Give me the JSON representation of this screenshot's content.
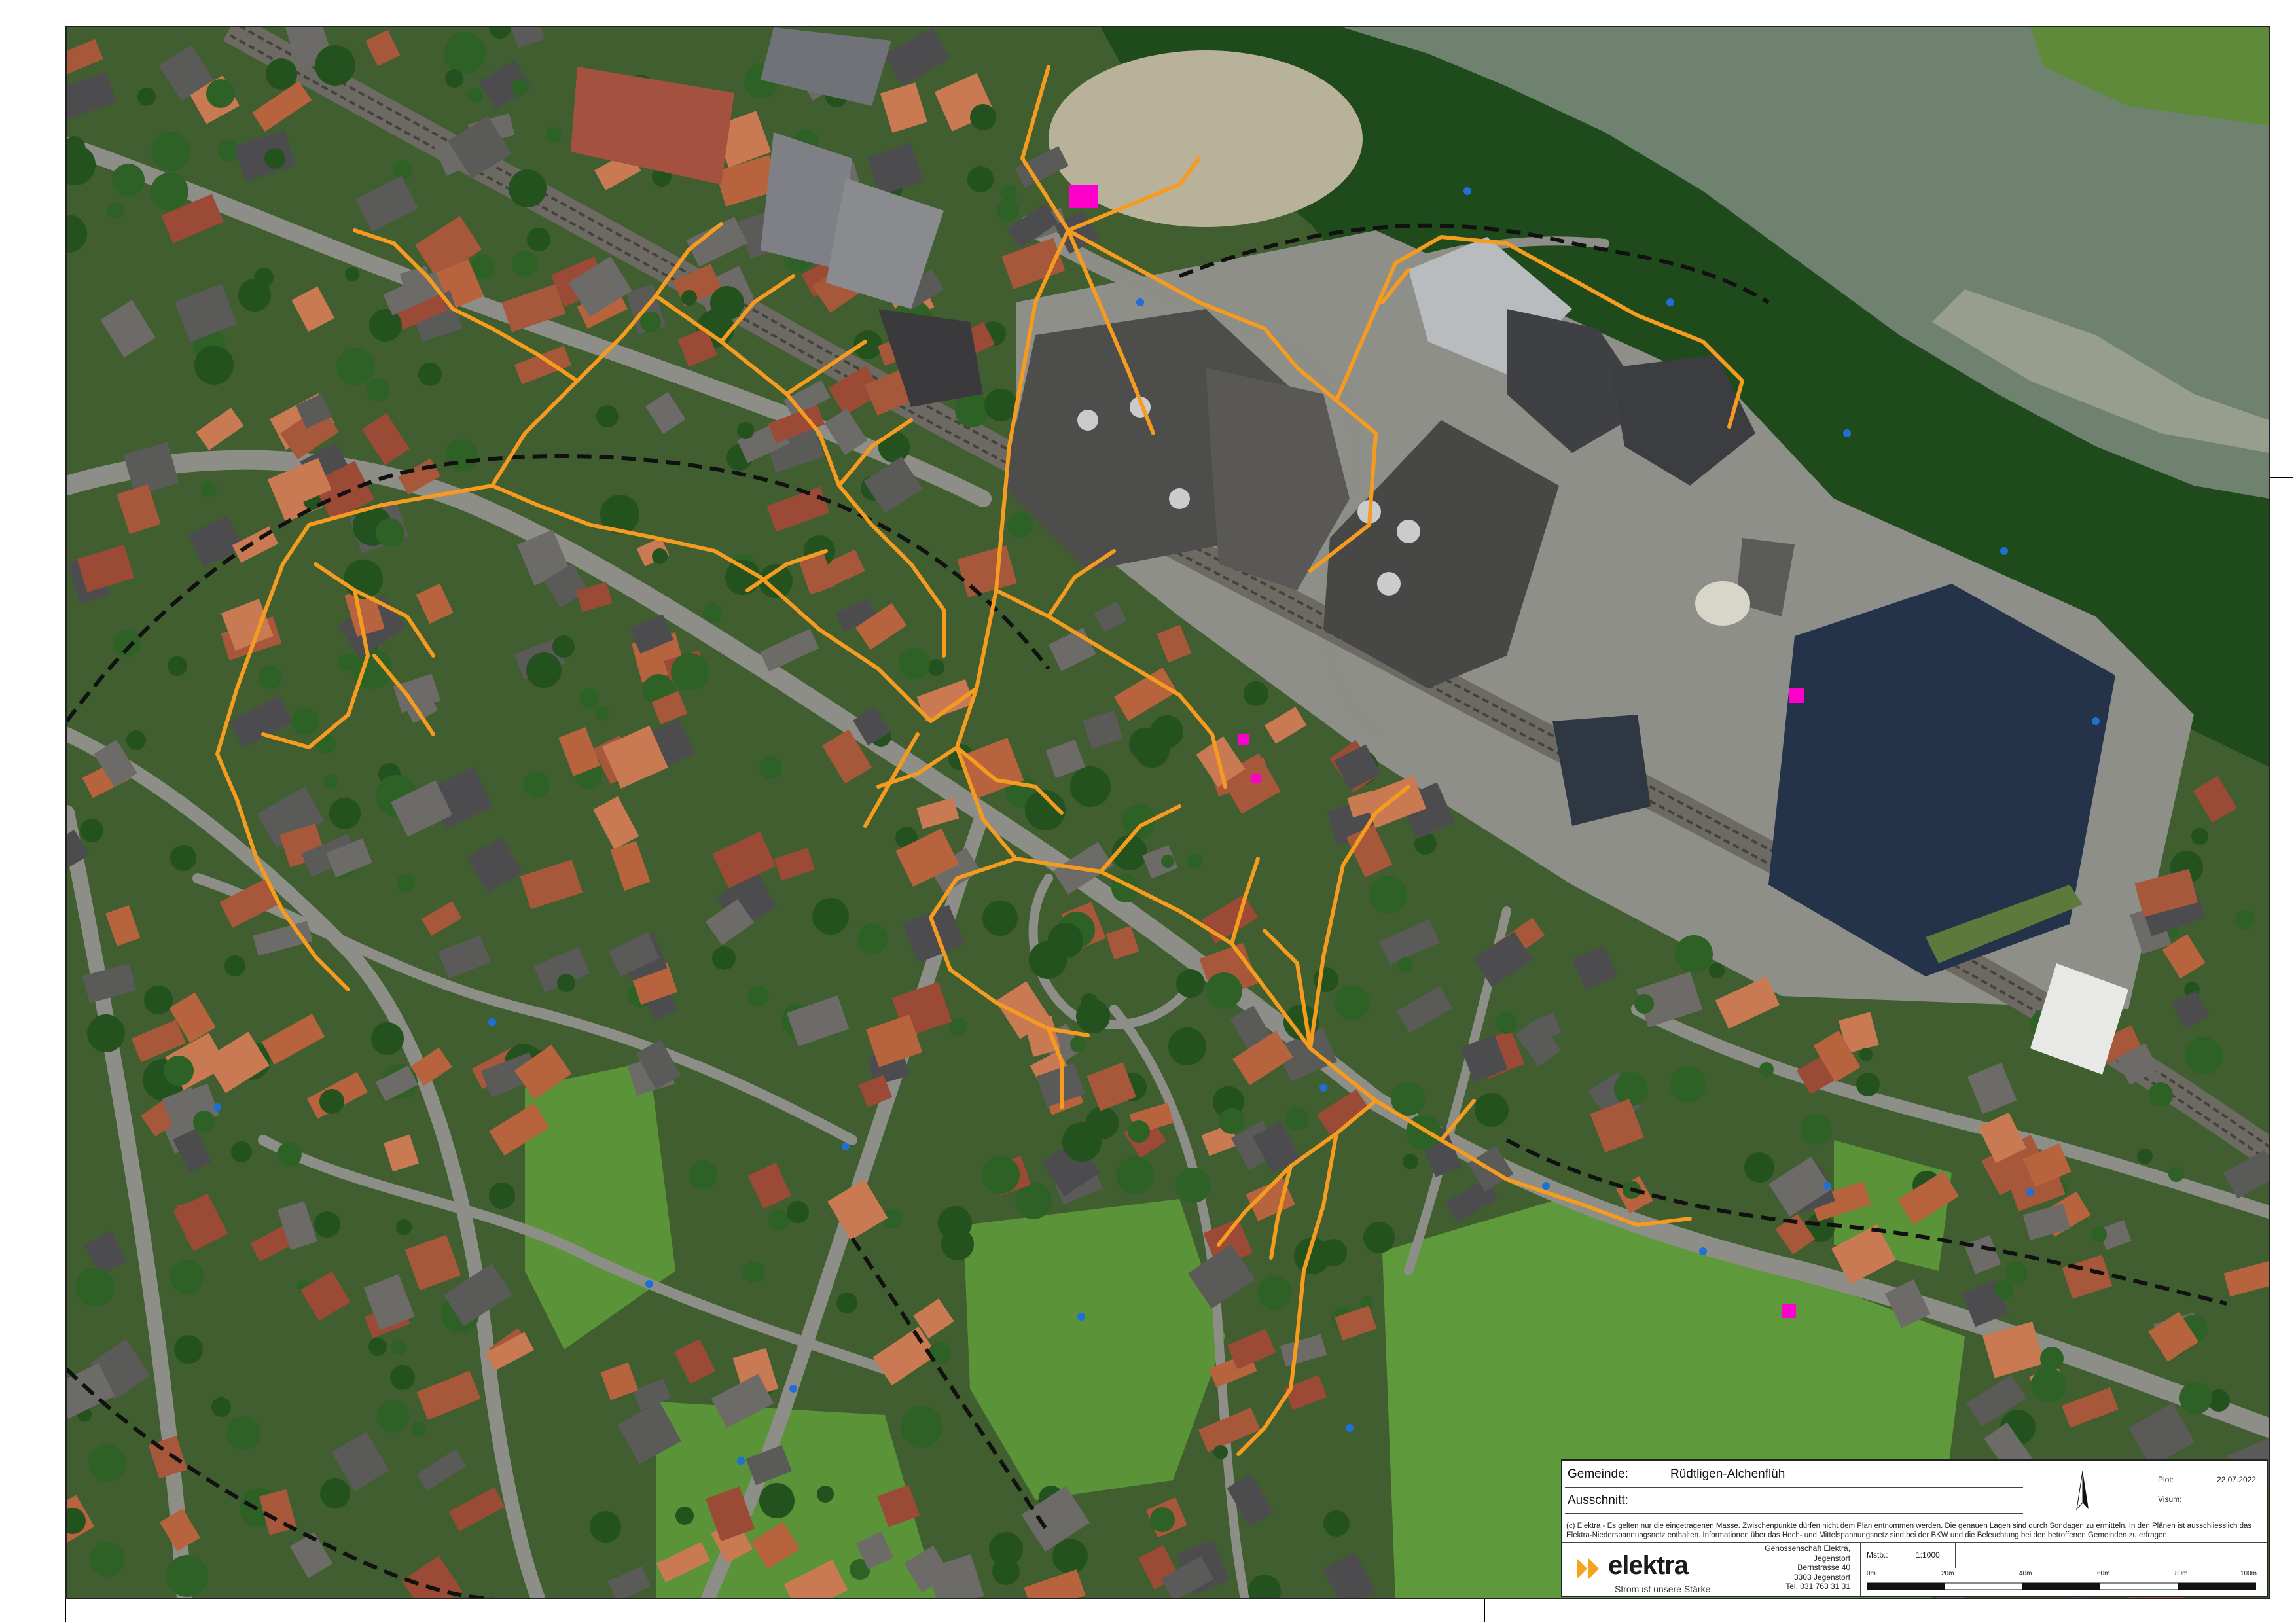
{
  "map": {
    "layers": [
      "aerial-orthophoto",
      "buildings",
      "roads",
      "railway",
      "river",
      "municipal-boundary",
      "cable-network"
    ],
    "colors": {
      "cable_line": "#f59b1f",
      "boundary": "#111111",
      "marker": "#ff00cc",
      "manhole": "#1f6fd6",
      "grass": "#3f7a2c",
      "forest": "#1f4a1c",
      "road": "#8c8c86",
      "roof_red": "#b7643e",
      "roof_grey": "#5a5a58",
      "river": "#6b7d6a"
    },
    "symbols": [
      "distribution-cabinet-marker",
      "manhole-point",
      "cable-line",
      "boundary-line"
    ]
  },
  "title_block": {
    "gemeinde_label": "Gemeinde:",
    "gemeinde_value": "Rüdtligen-Alchenflüh",
    "ausschnitt_label": "Ausschnitt:",
    "ausschnitt_value": "",
    "plot_label": "Plot:",
    "plot_value": "22.07.2022",
    "visum_label": "Visum:",
    "visum_value": "",
    "disclaimer": "(c) Elektra - Es gelten nur die eingetragenen Masse.  Zwischenpunkte dürfen nicht dem Plan entnommen werden. Die genauen Lagen sind durch Sondagen zu ermitteln. In den Plänen ist ausschliesslich das Elektra-Niederspannungsnetz enthalten. Informationen über das Hoch- und Mittelspannungsnetz sind bei der BKW und die Beleuchtung bei den betroffenen Gemeinden zu erfragen.",
    "logo_text": "elektra",
    "logo_slogan": "Strom ist unsere Stärke",
    "address": [
      "Genossenschaft Elektra,",
      "Jegenstorf",
      "Bernstrasse 40",
      "3303 Jegenstorf",
      "Tel. 031 763 31 31"
    ],
    "scale_label": "Mstb.:",
    "scale_value": "1:1000",
    "scale_ticks": [
      "0m",
      "20m",
      "40m",
      "60m",
      "80m",
      "100m"
    ],
    "north_arrow": "north-arrow-icon"
  }
}
